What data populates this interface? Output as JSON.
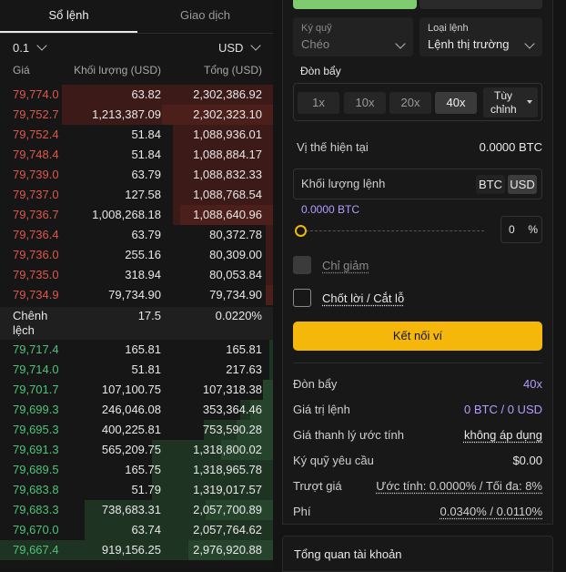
{
  "tabs": {
    "order_book": "Sổ lệnh",
    "trades": "Giao dịch"
  },
  "controls": {
    "tick_size": "0.1",
    "unit": "USD"
  },
  "headers": {
    "price": "Giá",
    "size": "Khối lượng (USD)",
    "total": "Tổng (USD)"
  },
  "asks": [
    {
      "price": "79,774.0",
      "size": "63.82",
      "total": "2,302,386.92"
    },
    {
      "price": "79,752.7",
      "size": "1,213,387.09",
      "total": "2,302,323.10"
    },
    {
      "price": "79,752.4",
      "size": "51.84",
      "total": "1,088,936.01"
    },
    {
      "price": "79,748.4",
      "size": "51.84",
      "total": "1,088,884.17"
    },
    {
      "price": "79,739.0",
      "size": "63.79",
      "total": "1,088,832.33"
    },
    {
      "price": "79,737.0",
      "size": "127.58",
      "total": "1,088,768.54"
    },
    {
      "price": "79,736.7",
      "size": "1,008,268.18",
      "total": "1,088,640.96"
    },
    {
      "price": "79,736.4",
      "size": "63.79",
      "total": "80,372.78"
    },
    {
      "price": "79,736.0",
      "size": "255.16",
      "total": "80,309.00"
    },
    {
      "price": "79,735.0",
      "size": "318.94",
      "total": "80,053.84"
    },
    {
      "price": "79,734.9",
      "size": "79,734.90",
      "total": "79,734.90"
    }
  ],
  "spread": {
    "label_line1": "Chênh",
    "label_line2": "lệch",
    "value": "17.5",
    "percent": "0.0220%"
  },
  "bids": [
    {
      "price": "79,717.4",
      "size": "165.81",
      "total": "165.81"
    },
    {
      "price": "79,714.0",
      "size": "51.81",
      "total": "217.63"
    },
    {
      "price": "79,701.7",
      "size": "107,100.75",
      "total": "107,318.38"
    },
    {
      "price": "79,699.3",
      "size": "246,046.08",
      "total": "353,364.46"
    },
    {
      "price": "79,695.3",
      "size": "400,225.81",
      "total": "753,590.28"
    },
    {
      "price": "79,691.3",
      "size": "565,209.75",
      "total": "1,318,800.02"
    },
    {
      "price": "79,689.5",
      "size": "165.75",
      "total": "1,318,965.78"
    },
    {
      "price": "79,683.8",
      "size": "51.79",
      "total": "1,319,017.57"
    },
    {
      "price": "79,683.3",
      "size": "738,683.31",
      "total": "2,057,700.89"
    },
    {
      "price": "79,670.0",
      "size": "63.74",
      "total": "2,057,764.62"
    },
    {
      "price": "79,667.4",
      "size": "919,156.25",
      "total": "2,976,920.88"
    }
  ],
  "form": {
    "margin_label": "Ký quỹ",
    "margin_value": "Chéo",
    "order_type_label": "Loại lệnh",
    "order_type_value": "Lệnh thị trường",
    "leverage_label": "Đòn bẩy",
    "leverage_options": [
      "1x",
      "10x",
      "20x",
      "40x"
    ],
    "leverage_custom_line1": "Tùy",
    "leverage_custom_line2": "chỉnh",
    "position_label": "Vị thế hiện tại",
    "position_value": "0.0000 BTC",
    "size_placeholder": "Khối lượng lệnh",
    "unit_btc": "BTC",
    "unit_usd": "USD",
    "size_btc": "0.0000 BTC",
    "percent_value": "0",
    "percent_sign": "%",
    "reduce_only": "Chỉ giảm",
    "tp_sl": "Chốt lời / Cắt lỗ",
    "connect_wallet": "Kết nối ví"
  },
  "summary": [
    {
      "k": "Đòn bẩy",
      "v": "40x"
    },
    {
      "k": "Giá trị lệnh",
      "v": "0 BTC / 0 USD"
    },
    {
      "k": "Giá thanh lý ước tính",
      "v": "không áp dụng"
    },
    {
      "k": "Ký quỹ yêu cầu",
      "v": "$0.00"
    },
    {
      "k": "Trượt giá",
      "v": "Ước tính: 0.0000% / Tối đa: 8%"
    },
    {
      "k": "Phí",
      "v": "0.0340% / 0.0110%"
    }
  ],
  "account_overview": "Tổng quan tài khoản",
  "colors": {
    "ask": "#e0564b",
    "bid": "#4ec27a",
    "accent": "#f5b80a",
    "purple": "#a78bfa"
  }
}
